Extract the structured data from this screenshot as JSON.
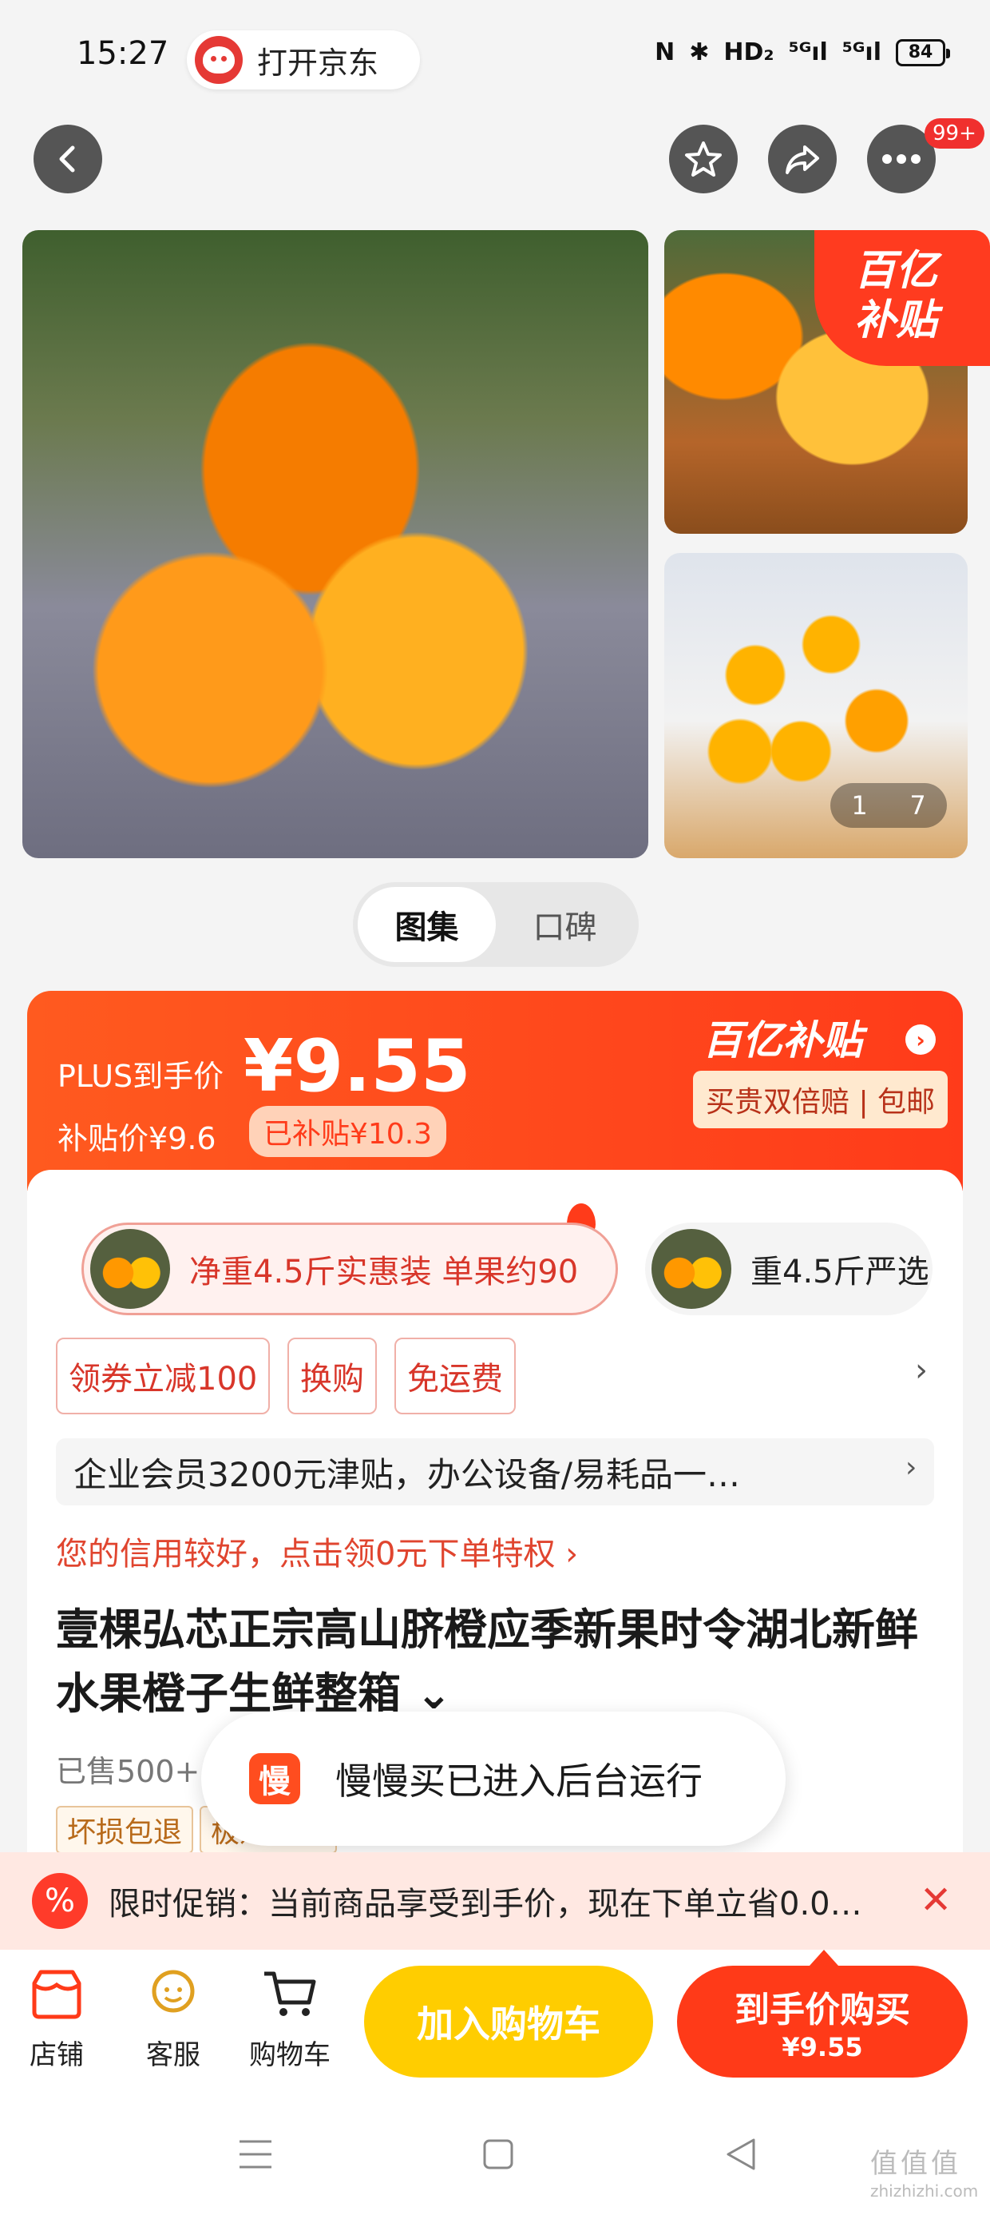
{
  "status_bar": {
    "time": "15:27",
    "open_jd": "打开京东",
    "icons": [
      "N",
      "✱",
      "HD₂",
      "⁵ᴳıl",
      "⁵ᴳıl"
    ],
    "battery": "84"
  },
  "nav": {
    "more_badge": "99+"
  },
  "gallery": {
    "subsidy_corner": "百亿\n补贴",
    "page_current": "1",
    "page_total": "7"
  },
  "tabs": [
    {
      "label": "图集"
    },
    {
      "label": "口碑"
    }
  ],
  "price": {
    "plus_label": "PLUS到手价",
    "plus_price": "¥9.55",
    "subsidy_label": "补贴价¥9.6",
    "subsidy_tag": "已补贴¥10.3",
    "program_title": "百亿补贴",
    "program_sub": "买贵双倍赔 | 包邮"
  },
  "specs": [
    {
      "label": "净重4.5斤实惠装 单果约90"
    },
    {
      "label": "重4.5斤严选"
    }
  ],
  "coupons": [
    {
      "label": "领券立减100"
    },
    {
      "label": "换购"
    },
    {
      "label": "免运费"
    }
  ],
  "business_row": "企业会员3200元津贴，办公设备/易耗品一…",
  "credit_row": "您的信用较好，点击领0元下单特权 ›",
  "product_title": "壹棵弘芯正宗高山脐橙应季新果时令湖北新鲜水果橙子生鲜整箱 ⌄",
  "sold": "已售500+",
  "service_tags": [
    "坏损包退",
    "极速退款"
  ],
  "toast": {
    "icon": "慢",
    "text": "慢慢买已进入后台运行"
  },
  "promo": {
    "icon": "%",
    "text": "限时促销：当前商品享受到手价，现在下单立省0.0…"
  },
  "bottom": {
    "store": "店铺",
    "service": "客服",
    "cart": "购物车",
    "add_to_cart": "加入购物车",
    "buy_label": "到手价购买",
    "buy_price": "¥9.55"
  },
  "watermark": {
    "text": "值值值",
    "url": "zhizhizhi.com"
  },
  "colors": {
    "accent": "#ff3a18",
    "cart_button": "#ffcd00",
    "promo_bg": "#ffe8e2"
  }
}
